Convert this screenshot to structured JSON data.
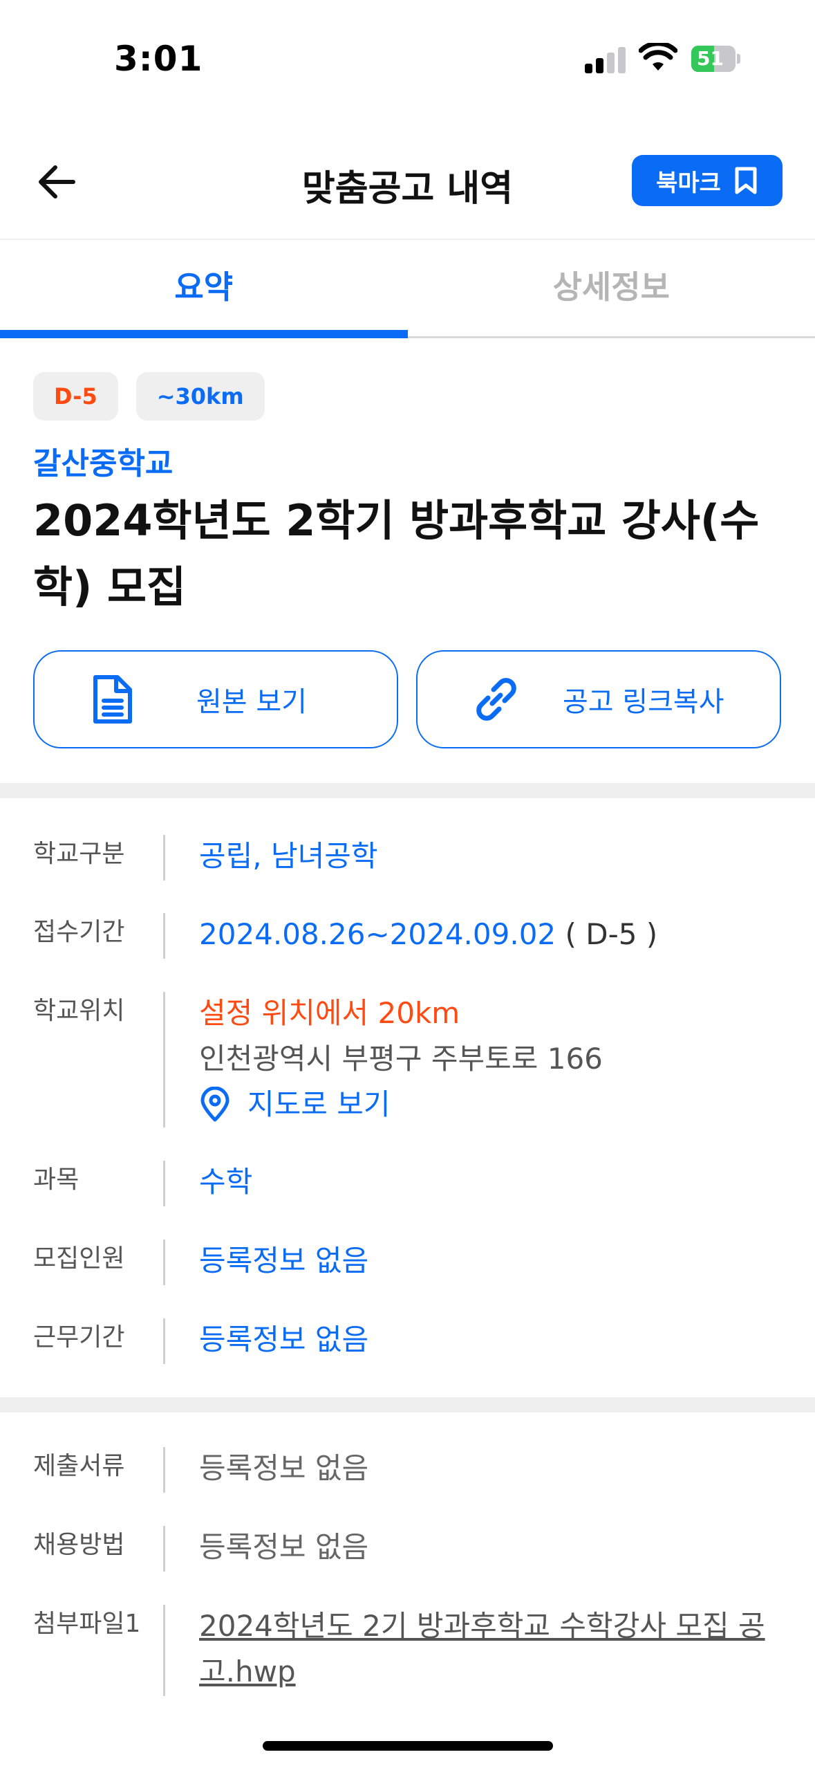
{
  "status_bar": {
    "time": "3:01",
    "battery": "51",
    "battery_level": 0.51
  },
  "header": {
    "title": "맞춤공고 내역",
    "bookmark_label": "북마크"
  },
  "tabs": [
    {
      "label": "요약",
      "active": true
    },
    {
      "label": "상세정보",
      "active": false
    }
  ],
  "badges": {
    "dday": "D-5",
    "distance": "~30km"
  },
  "post": {
    "school": "갈산중학교",
    "title": "2024학년도 2학기 방과후학교 강사(수학) 모집"
  },
  "actions": {
    "view_original": "원본 보기",
    "copy_link": "공고 링크복사"
  },
  "info": {
    "school_type": {
      "label": "학교구분",
      "value": "공립, 남녀공학"
    },
    "period": {
      "label": "접수기간",
      "value": "2024.08.26~2024.09.02",
      "dday": "( D-5 )"
    },
    "location": {
      "label": "학교위치",
      "distance": "설정 위치에서 20km",
      "address": "인천광역시 부평구 주부토로 166",
      "map_link": "지도로 보기"
    },
    "subject": {
      "label": "과목",
      "value": "수학"
    },
    "headcount": {
      "label": "모집인원",
      "value": "등록정보 없음"
    },
    "work_period": {
      "label": "근무기간",
      "value": "등록정보 없음"
    }
  },
  "extra": {
    "documents": {
      "label": "제출서류",
      "value": "등록정보 없음"
    },
    "method": {
      "label": "채용방법",
      "value": "등록정보 없음"
    },
    "attachment": {
      "label": "첨부파일1",
      "value": "2024학년도 2기 방과후학교 수학강사 모집 공고.hwp"
    }
  },
  "colors": {
    "accent": "#0a6cf5",
    "warning": "#ff4a12",
    "battery": "#34c759"
  }
}
